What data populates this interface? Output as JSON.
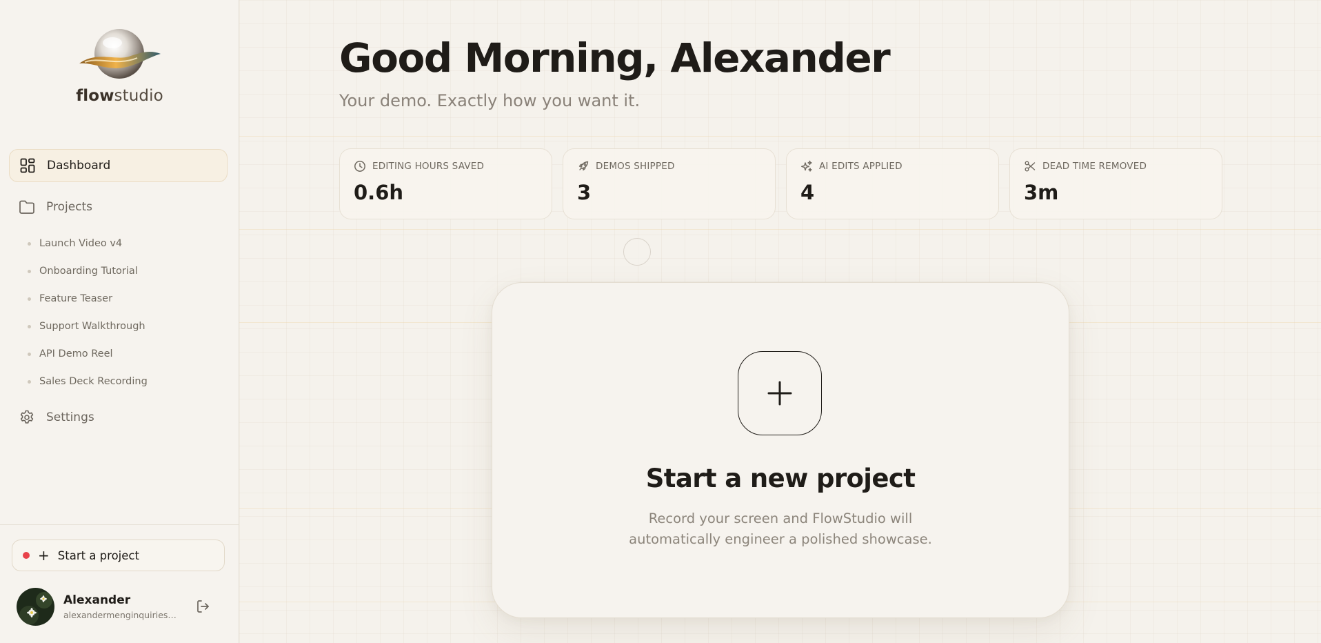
{
  "brand": {
    "name_bold": "flow",
    "name_rest": "studio"
  },
  "nav": {
    "dashboard": "Dashboard",
    "projects": "Projects",
    "settings": "Settings",
    "project_items": [
      "Launch Video v4",
      "Onboarding Tutorial",
      "Feature Teaser",
      "Support Walkthrough",
      "API Demo Reel",
      "Sales Deck Recording"
    ]
  },
  "sidebar_footer": {
    "start_label": "Start a project"
  },
  "user": {
    "name": "Alexander",
    "email": "alexandermenginquiries@g..."
  },
  "header": {
    "greeting": "Good Morning, Alexander",
    "tagline": "Your demo. Exactly how you want it."
  },
  "stats": [
    {
      "label": "EDITING HOURS SAVED",
      "value": "0.6h",
      "icon": "clock-icon"
    },
    {
      "label": "DEMOS SHIPPED",
      "value": "3",
      "icon": "rocket-icon"
    },
    {
      "label": "AI EDITS APPLIED",
      "value": "4",
      "icon": "sparkles-icon"
    },
    {
      "label": "DEAD TIME REMOVED",
      "value": "3m",
      "icon": "scissors-icon"
    }
  ],
  "new_project": {
    "title": "Start a new project",
    "desc_line1": "Record your screen and FlowStudio will",
    "desc_line2": "automatically engineer a polished showcase."
  },
  "colors": {
    "background": "#f5f2ec",
    "accent_active": "#f7f0e3",
    "record_dot": "#e8424a",
    "text_primary": "#1f1c18",
    "text_muted": "#8a8279"
  }
}
